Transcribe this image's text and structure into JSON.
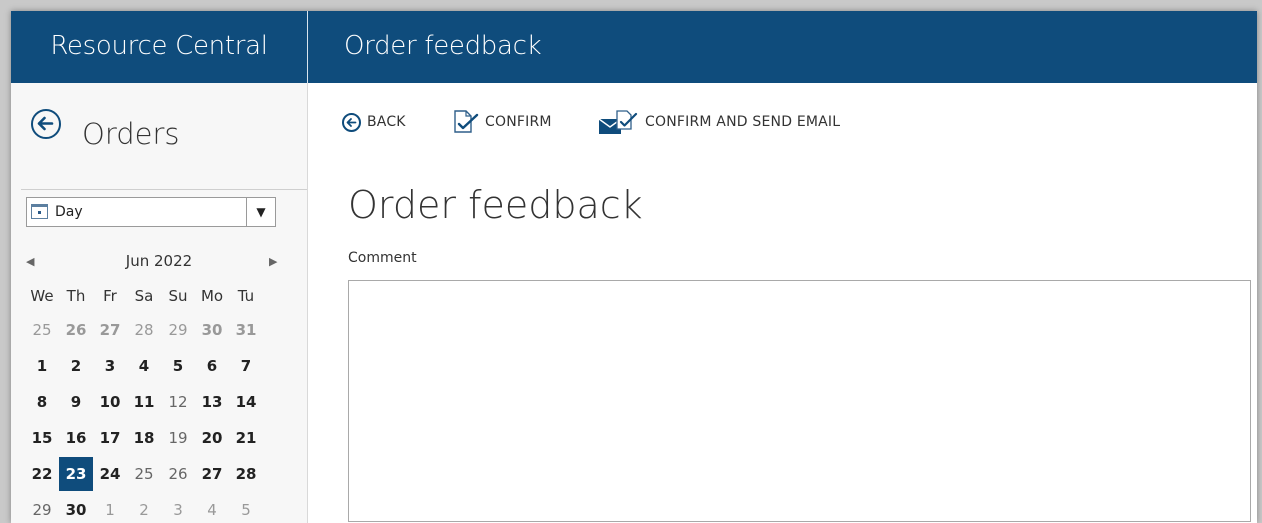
{
  "header": {
    "app_title": "Resource Central",
    "page_title": "Order feedback"
  },
  "sidebar": {
    "title": "Orders",
    "period_select": {
      "value": "Day"
    },
    "calendar": {
      "month_label": "Jun 2022",
      "weekdays": [
        "We",
        "Th",
        "Fr",
        "Sa",
        "Su",
        "Mo",
        "Tu"
      ],
      "weeks": [
        [
          "25",
          "26",
          "27",
          "28",
          "29",
          "30",
          "31"
        ],
        [
          "1",
          "2",
          "3",
          "4",
          "5",
          "6",
          "7"
        ],
        [
          "8",
          "9",
          "10",
          "11",
          "12",
          "13",
          "14"
        ],
        [
          "15",
          "16",
          "17",
          "18",
          "19",
          "20",
          "21"
        ],
        [
          "22",
          "23",
          "24",
          "25",
          "26",
          "27",
          "28"
        ],
        [
          "29",
          "30",
          "1",
          "2",
          "3",
          "4",
          "5"
        ]
      ],
      "selected_day": "23"
    }
  },
  "toolbar": {
    "back_label": "BACK",
    "confirm_label": "CONFIRM",
    "confirm_email_label": "CONFIRM AND SEND EMAIL"
  },
  "form": {
    "title": "Order feedback",
    "comment_label": "Comment",
    "comment_value": ""
  },
  "colors": {
    "accent": "#0f4c7c",
    "header_bg": "#0f4c7c"
  }
}
